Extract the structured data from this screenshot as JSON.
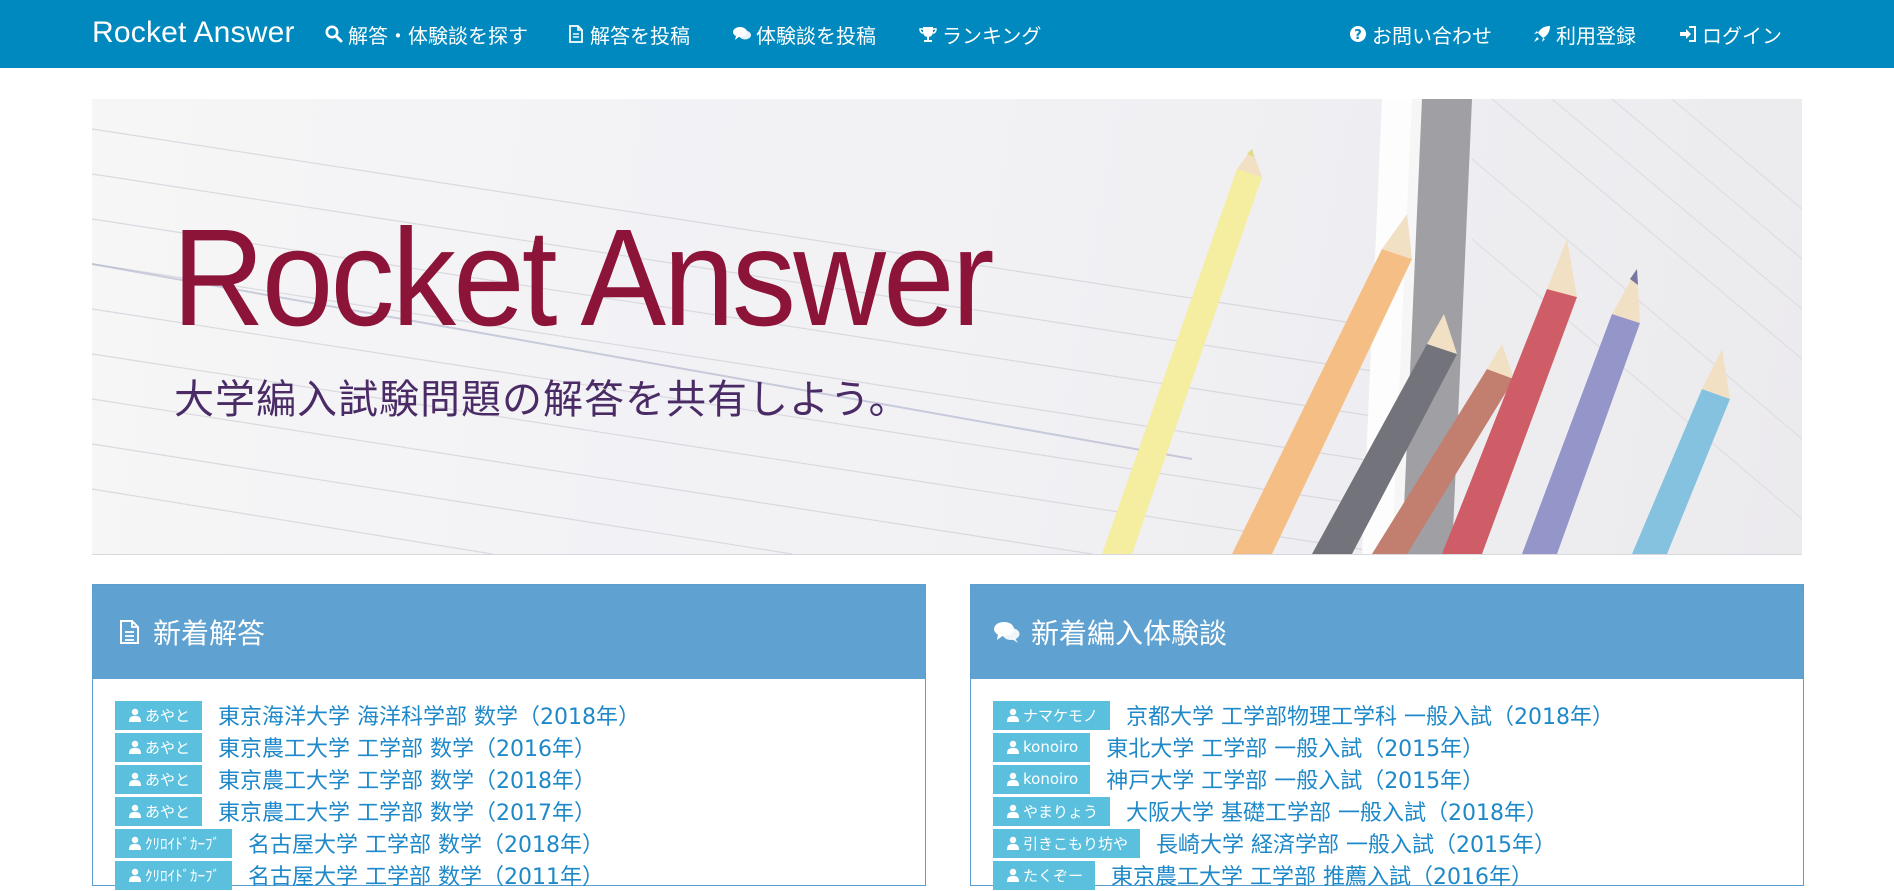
{
  "navbar": {
    "brand": "Rocket Answer",
    "items": [
      {
        "label": "解答・体験談を探す",
        "icon": "search-icon"
      },
      {
        "label": "解答を投稿",
        "icon": "file-icon"
      },
      {
        "label": "体験談を投稿",
        "icon": "comments-icon"
      },
      {
        "label": "ランキング",
        "icon": "trophy-icon"
      }
    ],
    "right_items": [
      {
        "label": "お問い合わせ",
        "icon": "question-circle-icon"
      },
      {
        "label": "利用登録",
        "icon": "rocket-icon"
      },
      {
        "label": "ログイン",
        "icon": "sign-in-icon"
      }
    ]
  },
  "hero": {
    "title": "Rocket Answer",
    "subtitle": "大学編入試験問題の解答を共有しよう。"
  },
  "answers_panel": {
    "title": "新着解答",
    "icon": "file-text-icon",
    "entries": [
      {
        "user": "あやと",
        "title": "東京海洋大学 海洋科学部 数学（2018年）"
      },
      {
        "user": "あやと",
        "title": "東京農工大学 工学部 数学（2016年）"
      },
      {
        "user": "あやと",
        "title": "東京農工大学 工学部 数学（2018年）"
      },
      {
        "user": "あやと",
        "title": "東京農工大学 工学部 数学（2017年）"
      },
      {
        "user": "ｸﾘﾛｲﾄﾞｶｰﾌﾞ",
        "title": "名古屋大学 工学部 数学（2018年）"
      },
      {
        "user": "ｸﾘﾛｲﾄﾞｶｰﾌﾞ",
        "title": "名古屋大学 工学部 数学（2011年）"
      }
    ]
  },
  "experiences_panel": {
    "title": "新着編入体験談",
    "icon": "comments-icon",
    "entries": [
      {
        "user": "ナマケモノ",
        "title": "京都大学 工学部物理工学科 一般入試（2018年）"
      },
      {
        "user": "konoiro",
        "title": "東北大学 工学部 一般入試（2015年）"
      },
      {
        "user": "konoiro",
        "title": "神戸大学 工学部 一般入試（2015年）"
      },
      {
        "user": "やまりょう",
        "title": "大阪大学 基礎工学部 一般入試（2018年）"
      },
      {
        "user": "引きこもり坊や",
        "title": "長崎大学 経済学部 一般入試（2015年）"
      },
      {
        "user": "たくぞー",
        "title": "東京農工大学 工学部 推薦入試（2016年）"
      }
    ]
  },
  "colors": {
    "navbar": "#0089be",
    "panel_header": "#5fa1d0",
    "badge": "#5bc0de",
    "link": "#1e88c8",
    "hero_title": "#8c1438",
    "hero_subtitle": "#4a2b66"
  }
}
